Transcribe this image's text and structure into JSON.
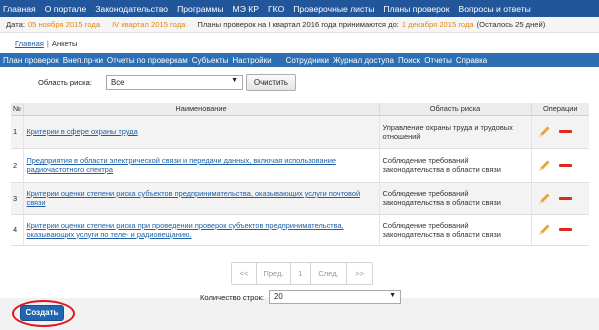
{
  "top_nav": [
    "Главная",
    "О портале",
    "Законодательство",
    "Программы",
    "МЭ КР",
    "ГКО",
    "Проверочные листы",
    "Планы проверок",
    "Вопросы и ответы"
  ],
  "info_bar": {
    "date_label": "Дата:",
    "date_value": "05 ноября 2015 года",
    "quarter_value": "IV квартал 2015 года",
    "plans_text": "Планы проверок на I квартал 2016 года принимаются до:",
    "deadline_value": "1 декабря 2015 года",
    "remaining_text": "(Осталось 25 дней)"
  },
  "breadcrumb": {
    "home": "Главная",
    "separator": "|",
    "current": "Анкеты"
  },
  "sub_nav": [
    "План проверок",
    "Внеп.пр-ки",
    "Отчеты по проверкам",
    "Субъекты",
    "Настройки",
    "Сотрудники",
    "Журнал доступа",
    "Поиск",
    "Отчеты",
    "Справка"
  ],
  "filter": {
    "label": "Область риска:",
    "selected": "Все",
    "clear_label": "Очистить"
  },
  "table": {
    "headers": {
      "num": "№",
      "name": "Наименование",
      "area": "Область риска",
      "ops": "Операции"
    },
    "rows": [
      {
        "num": "1",
        "name": "Критерии в сфере охраны труда",
        "area": "Управление охраны труда и трудовых отношений"
      },
      {
        "num": "2",
        "name": "Предприятия в области электрической связи и передачи данных, включая использование радиочастотного спектра",
        "area": "Соблюдение требований законодательства в области связи"
      },
      {
        "num": "3",
        "name": "Критерии оценки степени риска субъектов предпринимательства, оказывающих услуги почтовой связи",
        "area": "Соблюдение требований законодательства в области связи"
      },
      {
        "num": "4",
        "name": "Критерии оценки степени риска при проведении проверок субъектов предпринимательства, оказывающих услуги по теле- и радиовещанию.",
        "area": "Соблюдение требований законодательства в области связи"
      }
    ]
  },
  "pager": {
    "first": "<<",
    "prev": "Пред.",
    "page": "1",
    "next": "След.",
    "last": ">>"
  },
  "rows_per_page": {
    "label": "Количество строк:",
    "selected": "20"
  },
  "create_label": "Создать",
  "colors": {
    "nav_bg": "#21569b",
    "subnav_bg": "#2c6fb3",
    "accent_orange": "#e08a14",
    "delete_red": "#d92a1c",
    "edit_orange": "#e8a33a",
    "create_button": "#2166b0",
    "highlight_ring": "#e0131f"
  }
}
